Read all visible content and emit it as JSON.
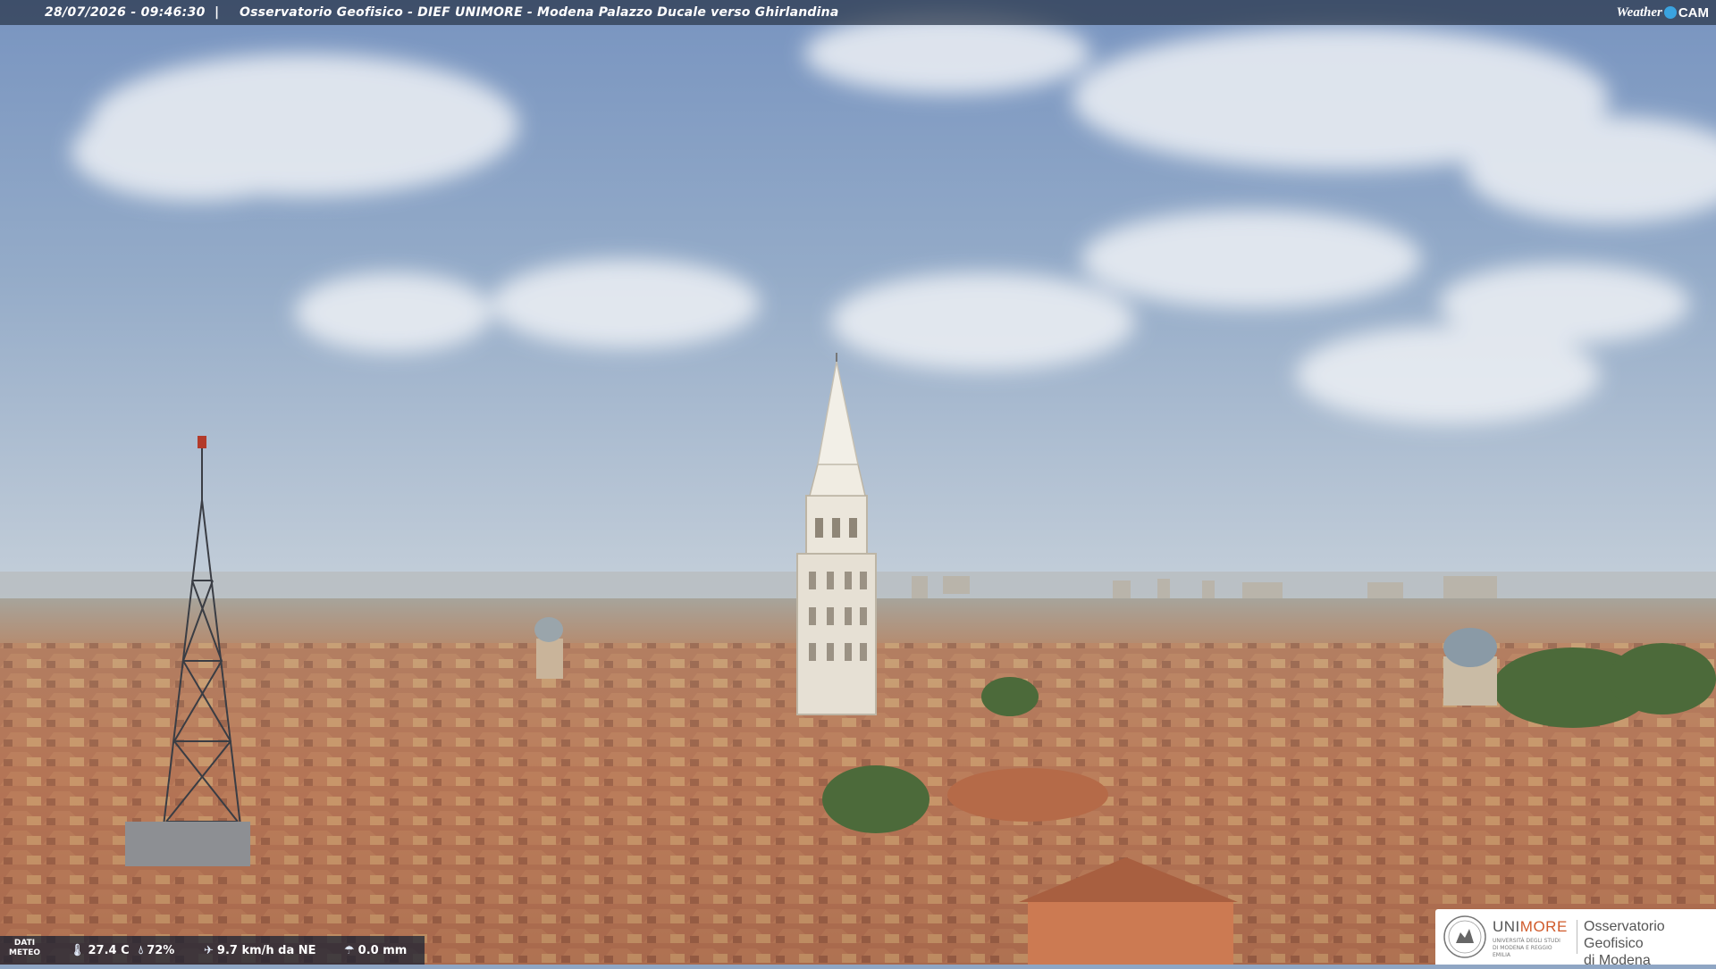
{
  "overlay": {
    "timestamp": "28/07/2026 - 09:46:30",
    "separator": "|",
    "title": "Osservatorio Geofisico - DIEF UNIMORE - Modena Palazzo Ducale verso Ghirlandina",
    "brand_weather": "Weather",
    "brand_cam": "CAM"
  },
  "meteo": {
    "label_line1": "DATI",
    "label_line2": "METEO",
    "temperature": "27.4 C",
    "humidity": "72%",
    "wind": "9.7 km/h da NE",
    "rain": "0.0 mm",
    "icons": [
      "thermometer-icon",
      "humidity-drop-icon",
      "wind-icon",
      "rain-icon"
    ]
  },
  "logo": {
    "uni_part1": "UNI",
    "uni_part2": "MORE",
    "uni_subtitle": "UNIVERSITÀ DEGLI STUDI DI MODENA E REGGIO EMILIA",
    "org_line1": "Osservatorio Geofisico",
    "org_line2": "di Modena"
  },
  "colors": {
    "sky_top": "#7f9bc4",
    "sky_horizon": "#c9d3dc",
    "roof": "#b07050",
    "tower": "#e8e2d6",
    "unimore_accent": "#d05a2a",
    "brand_dot": "#3aa3e0"
  }
}
